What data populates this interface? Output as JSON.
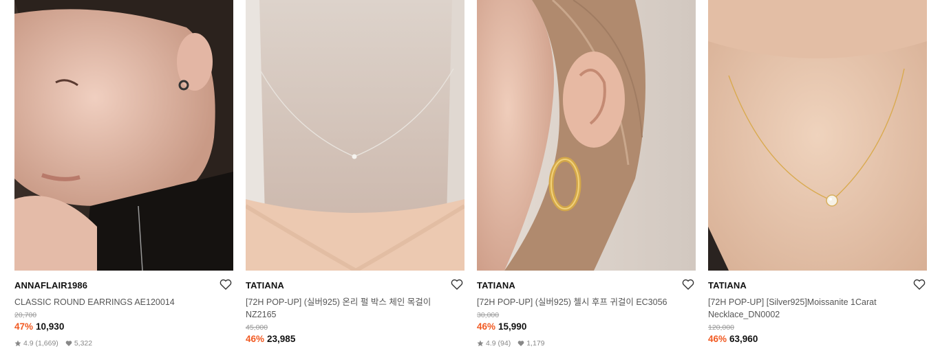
{
  "products": [
    {
      "brand": "ANNAFLAIR1986",
      "name_line1": "CLASSIC ROUND EARRINGS AE120014",
      "name_line2": "",
      "original_price": "20,700",
      "discount": "47%",
      "price": "10,930",
      "rating": "4.9",
      "reviews": "(1,669)",
      "likes": "5,322",
      "image": "woman-profile-earring-photo"
    },
    {
      "brand": "TATIANA",
      "name_line1": "[72H POP-UP] (실버925) 온리 펄 박스 체인 목걸이",
      "name_line2": "NZ2165",
      "original_price": "45,000",
      "discount": "46%",
      "price": "23,985",
      "image": "necklace-on-neck-photo"
    },
    {
      "brand": "TATIANA",
      "name_line1": "[72H POP-UP] (실버925) 첼시 후프 귀걸이 EC3056",
      "name_line2": "",
      "original_price": "30,000",
      "discount": "46%",
      "price": "15,990",
      "rating": "4.9",
      "reviews": "(94)",
      "likes": "1,179",
      "image": "gold-hoop-earring-photo"
    },
    {
      "brand": "TATIANA",
      "name_line1": "[72H POP-UP] [Silver925]Moissanite 1Carat",
      "name_line2": "Necklace_DN0002",
      "original_price": "120,000",
      "discount": "46%",
      "price": "63,960",
      "image": "moissanite-necklace-photo"
    }
  ],
  "colors": {
    "discount": "#f15a22",
    "brand": "#111111",
    "muted": "#999999"
  },
  "icons": [
    "heart-icon",
    "star-icon",
    "like-heart-icon"
  ]
}
